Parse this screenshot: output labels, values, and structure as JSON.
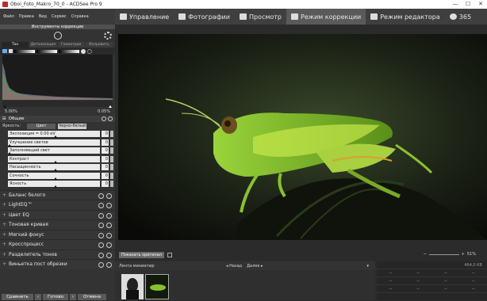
{
  "window": {
    "title": "Oboi_Foto_Makro_70_0 - ACDSee Pro 9",
    "buttons": [
      "—",
      "☐",
      "✕"
    ]
  },
  "menu": [
    "Файл",
    "Правка",
    "Вид",
    "Сервис",
    "Справка"
  ],
  "modes": [
    {
      "label": "Управление",
      "icon": "manage-icon"
    },
    {
      "label": "Фотографии",
      "icon": "photos-icon"
    },
    {
      "label": "Просмотр",
      "icon": "view-icon"
    },
    {
      "label": "Режим коррекции",
      "icon": "develop-icon",
      "active": true
    },
    {
      "label": "Режим редактора",
      "icon": "edit-icon"
    },
    {
      "label": "365",
      "icon": "cloud-365-icon"
    }
  ],
  "panel": {
    "header": "Инструменты коррекции",
    "tabs": [
      "Тон",
      "Детализация",
      "Геометрия",
      "Исправить"
    ],
    "clip_left": "5.00%",
    "clip_right": "0.05%",
    "general": {
      "title": "Общие",
      "mode_label": "Яркость:",
      "mode_color": "Цвет",
      "mode_bw": "Черно-белый",
      "sliders": [
        {
          "label": "Экспозиция = 0.00 eV",
          "value": "0",
          "level": 0.5
        },
        {
          "label": "Улучшение светов",
          "value": "0",
          "level": 0.0
        },
        {
          "label": "Заполняющий свет",
          "value": "0",
          "level": 0.0
        },
        {
          "label": "Контраст",
          "value": "0",
          "level": 0.5
        },
        {
          "label": "Насыщенность",
          "value": "0",
          "level": 0.5
        },
        {
          "label": "Сочность",
          "value": "0",
          "level": 0.5
        },
        {
          "label": "Ясность",
          "value": "0",
          "level": 0.5
        }
      ]
    },
    "accordions": [
      "Баланс белого",
      "LightEQ™",
      "Цвет EQ",
      "Тоновая кривая",
      "Мягкий фокус",
      "Кросспроцесс",
      "Разделитель тонов",
      "Виньетка пост обрезки"
    ],
    "bottom": {
      "compare": "Сравнить",
      "done": "Готово",
      "cancel": "Отмена"
    }
  },
  "status": {
    "show_original": "Показать оригинал",
    "zoom": "51%"
  },
  "filmstrip": {
    "header": "Лента миниатюр",
    "back": "Назад",
    "forward": "Далее"
  },
  "info": {
    "dimensions": "464,0 KB",
    "cells": [
      "--",
      "--",
      "--",
      "--",
      "--",
      "--",
      "--",
      "--",
      "--",
      "--",
      "--",
      "--"
    ]
  }
}
